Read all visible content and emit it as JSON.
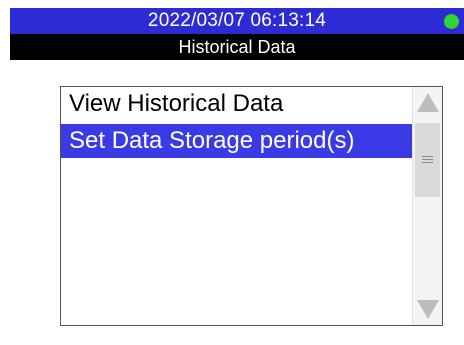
{
  "status_bar": {
    "datetime": "2022/03/07 06:13:14",
    "indicator_color": "#2fd62f",
    "background_color": "#2d2bd6"
  },
  "title_bar": {
    "title": "Historical Data"
  },
  "menu": {
    "items": [
      {
        "label": "View Historical Data",
        "selected": false
      },
      {
        "label": "Set Data Storage period(s)",
        "selected": true
      }
    ],
    "selection_color": "#3a3ae6"
  },
  "scrollbar": {
    "up_icon": "triangle-up-icon",
    "down_icon": "triangle-down-icon",
    "thumb_icon": "grip-lines-icon"
  }
}
